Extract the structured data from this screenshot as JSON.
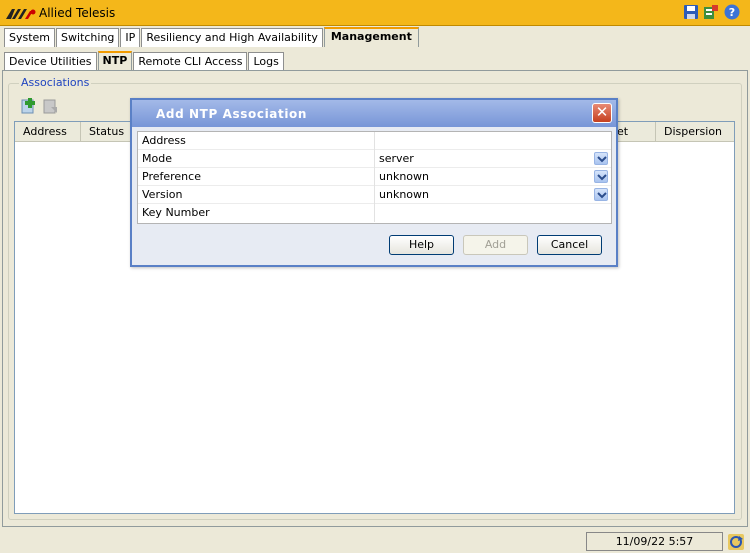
{
  "app": {
    "title": "Allied Telesis"
  },
  "main_tabs": [
    {
      "label": "System"
    },
    {
      "label": "Switching"
    },
    {
      "label": "IP"
    },
    {
      "label": "Resiliency and High Availability"
    },
    {
      "label": "Management",
      "active": true
    }
  ],
  "sub_tabs": [
    {
      "label": "Device Utilities"
    },
    {
      "label": "NTP",
      "active": true
    },
    {
      "label": "Remote CLI Access"
    },
    {
      "label": "Logs"
    }
  ],
  "associations": {
    "legend": "Associations",
    "columns": [
      "Address",
      "Status",
      "et",
      "Dispersion"
    ]
  },
  "dialog": {
    "title": "Add NTP Association",
    "fields": [
      {
        "label": "Address",
        "value": ""
      },
      {
        "label": "Mode",
        "value": "server",
        "dropdown": true
      },
      {
        "label": "Preference",
        "value": "unknown",
        "dropdown": true
      },
      {
        "label": "Version",
        "value": "unknown",
        "dropdown": true
      },
      {
        "label": "Key Number",
        "value": ""
      }
    ],
    "buttons": {
      "help": "Help",
      "add": "Add",
      "cancel": "Cancel"
    }
  },
  "status": {
    "datetime": "11/09/22 5:57"
  },
  "icons": {
    "save": "save-icon",
    "config": "config-icon",
    "help": "help-icon",
    "add": "add-icon",
    "delete": "delete-icon",
    "refresh": "refresh-icon"
  },
  "colors": {
    "titlebar": "#f4b71a",
    "tab_accent": "#f29b00",
    "dialog_title": "#7795d7",
    "legend": "#1f44c0"
  }
}
